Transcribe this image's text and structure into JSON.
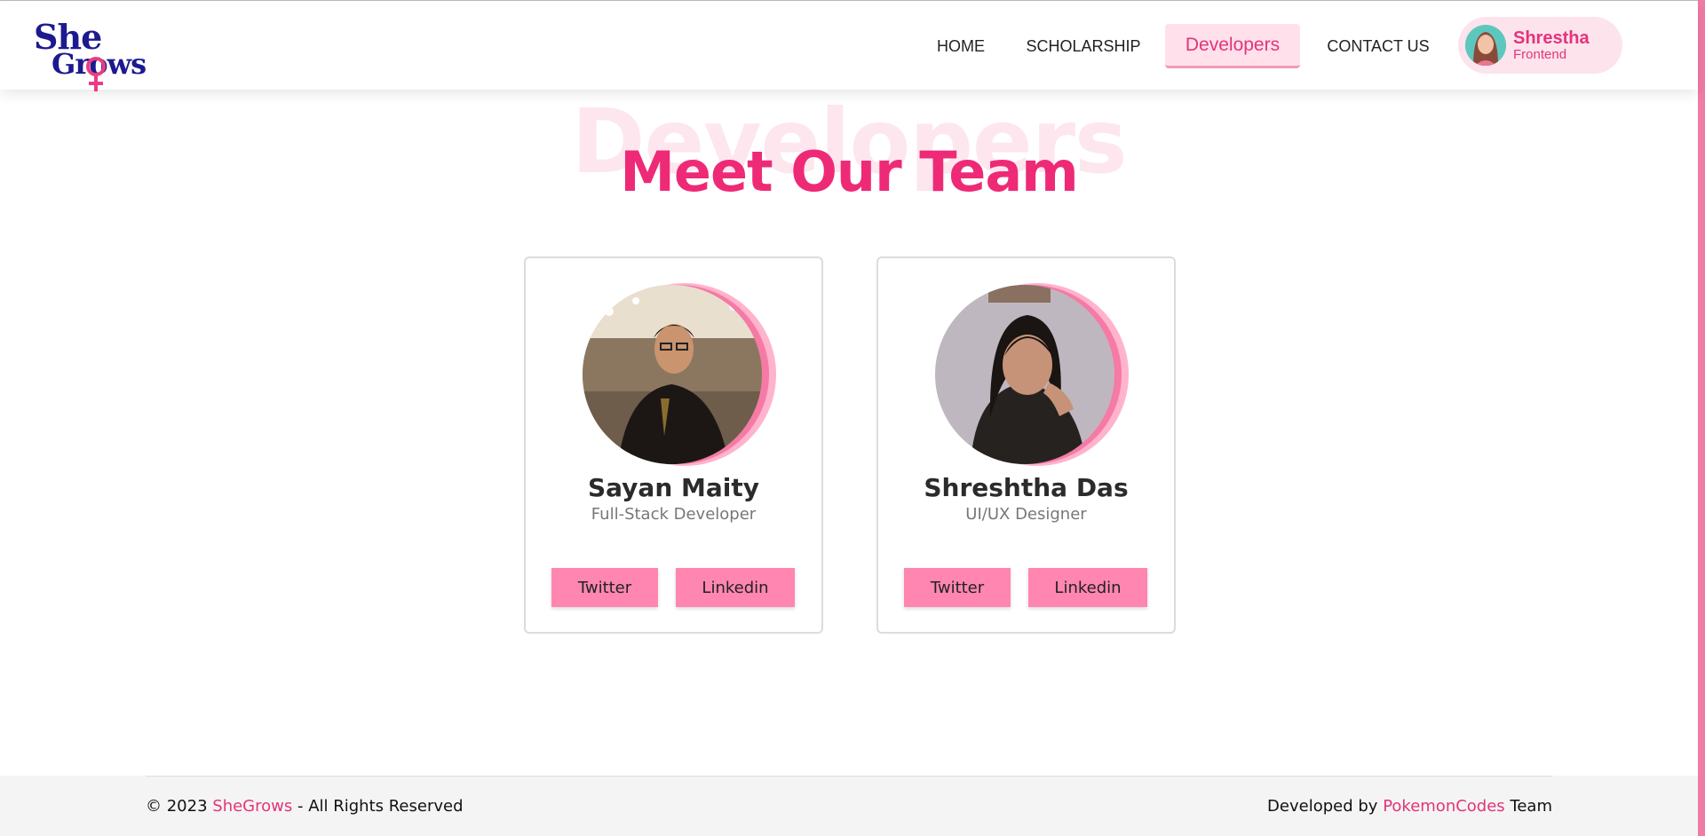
{
  "brand": {
    "line1": "She",
    "line2": "Grows"
  },
  "nav": {
    "home": "HOME",
    "scholarship": "SCHOLARSHIP",
    "developers": "Developers",
    "contact": "CONTACT US"
  },
  "profile": {
    "name": "Shrestha",
    "role": "Frontend"
  },
  "hero": {
    "background_word": "Developers",
    "title": "Meet Our Team"
  },
  "team": [
    {
      "name": "Sayan Maity",
      "role": "Full-Stack Developer",
      "twitter_label": "Twitter",
      "linkedin_label": "Linkedin"
    },
    {
      "name": "Shreshtha Das",
      "role": "UI/UX Designer",
      "twitter_label": "Twitter",
      "linkedin_label": "Linkedin"
    }
  ],
  "footer": {
    "copyright_prefix": "© 2023",
    "copyright_brand": "SheGrows",
    "copyright_suffix": "- All Rights Reserved",
    "dev_prefix": "Developed by",
    "dev_brand": "PokemonCodes",
    "dev_suffix": "Team"
  },
  "colors": {
    "accent": "#ee2a76",
    "button": "#ff86b0",
    "logo": "#1d1a8f",
    "right_bar": "#f07ba7"
  }
}
